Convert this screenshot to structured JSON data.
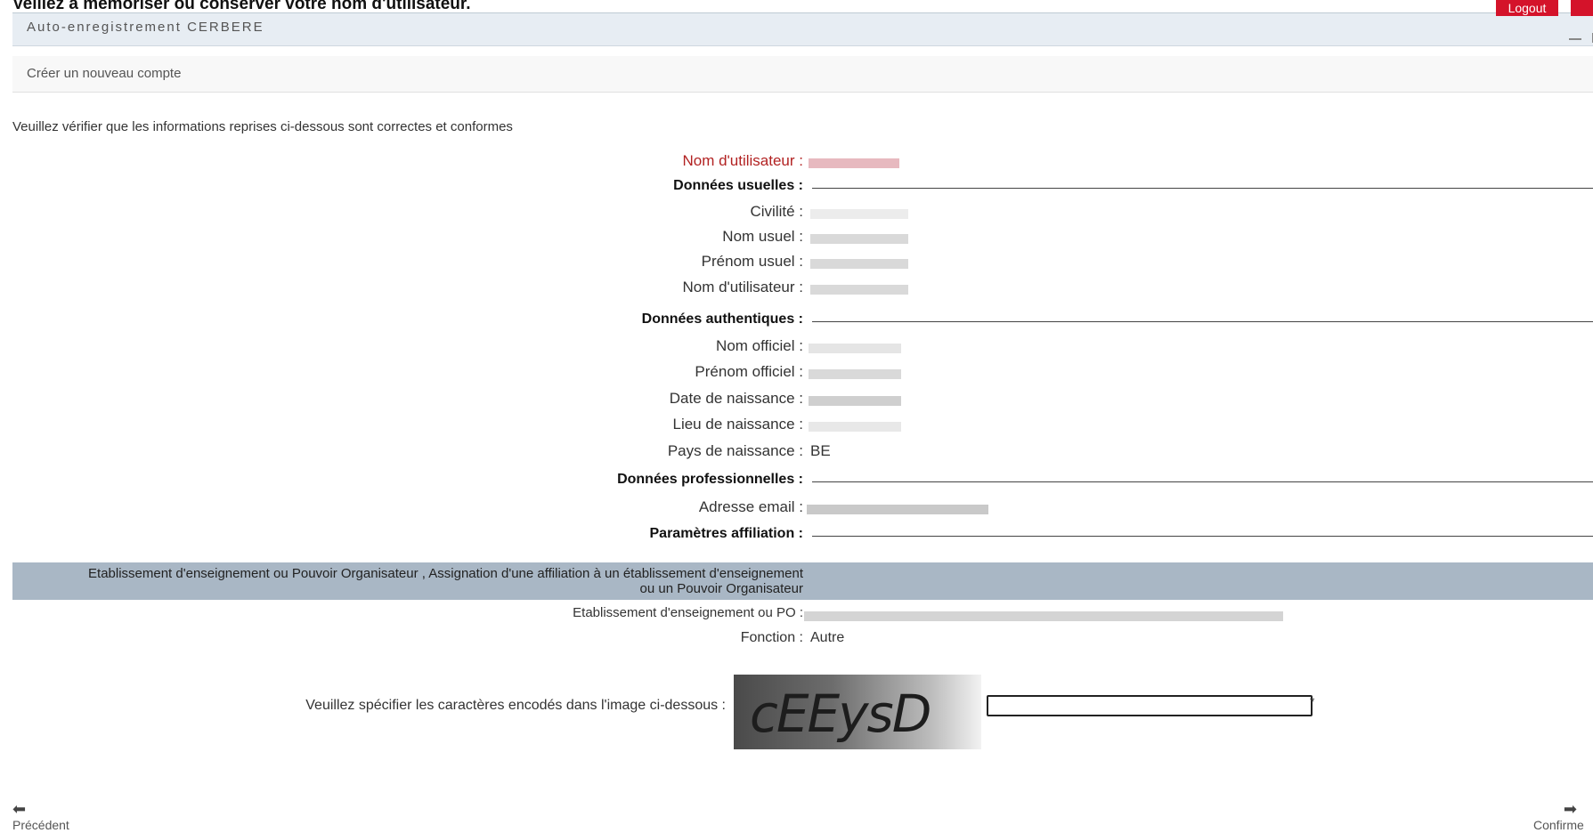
{
  "top_notice": "Veillez à mémoriser ou conserver votre nom d'utilisateur.",
  "header": {
    "title": "Auto-enregistrement CERBERE",
    "logout_label": "Logout"
  },
  "breadcrumb": "Créer un nouveau compte",
  "instruction": "Veuillez vérifier que les informations reprises ci-dessous sont correctes et conformes",
  "summary": {
    "username_label": "Nom d'utilisateur :",
    "sections": {
      "usual": "Données usuelles :",
      "authentic": "Données authentiques :",
      "professional": "Données professionnelles :",
      "affiliation": "Paramètres affiliation :"
    },
    "usual_fields": [
      {
        "label": "Civilité :"
      },
      {
        "label": "Nom usuel :"
      },
      {
        "label": "Prénom usuel :"
      },
      {
        "label": "Nom d'utilisateur :"
      }
    ],
    "authentic_fields": [
      {
        "label": "Nom officiel :"
      },
      {
        "label": "Prénom officiel :"
      },
      {
        "label": "Date de naissance :"
      },
      {
        "label": "Lieu de naissance :"
      },
      {
        "label": "Pays de naissance :",
        "value": "BE"
      }
    ],
    "email_label": "Adresse email :"
  },
  "affiliation": {
    "band_text": "Etablissement d'enseignement ou Pouvoir Organisateur , Assignation d'une affiliation à un établissement d'enseignement ou un Pouvoir Organisateur",
    "establishment_label": "Etablissement d'enseignement ou PO :",
    "function_label": "Fonction :",
    "function_value": "Autre"
  },
  "captcha": {
    "label": "Veuillez spécifier les caractères encodés dans l'image ci-dessous :",
    "image_text": "cEEysD",
    "input_value": "",
    "required_marker": "*"
  },
  "navigation": {
    "prev_label": "Précédent",
    "next_label": "Confirme"
  },
  "colors": {
    "accent_red": "#d4132a",
    "header_bg": "#e7edf3",
    "affiliation_band": "#a9b7c5",
    "username_highlight": "#b22222"
  }
}
